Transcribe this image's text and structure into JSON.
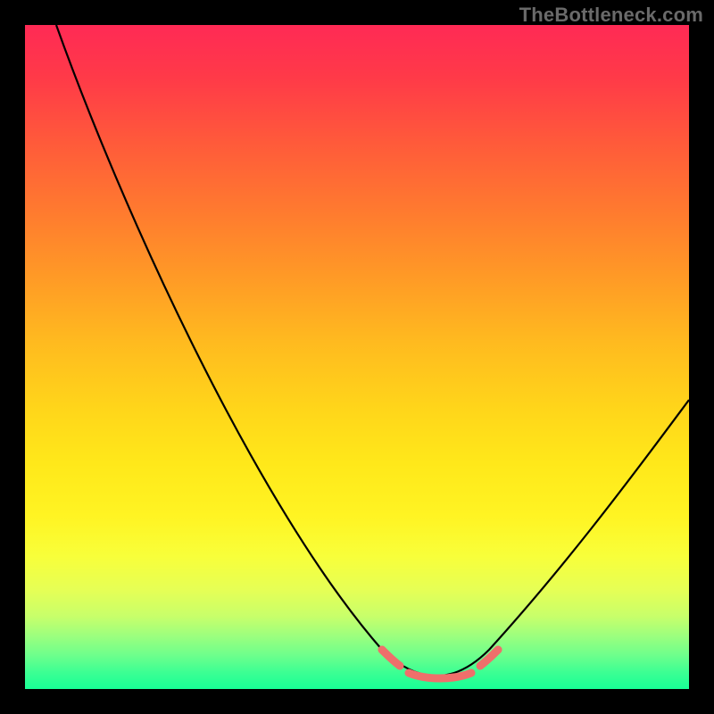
{
  "watermark": "TheBottleneck.com",
  "colors": {
    "frame_background": "#000000",
    "curve_stroke": "#000000",
    "accent_stroke": "#ef6f6b",
    "gradient_top": "#ff2a55",
    "gradient_bottom": "#18ff96",
    "watermark_text": "#6a6a6a"
  },
  "chart_data": {
    "type": "line",
    "title": "",
    "xlabel": "",
    "ylabel": "",
    "xlim": [
      0,
      100
    ],
    "ylim": [
      0,
      100
    ],
    "grid": false,
    "legend": false,
    "background": "vertical heat gradient (red high → green low)",
    "series": [
      {
        "name": "bottleneck-curve",
        "x": [
          5,
          10,
          20,
          30,
          40,
          50,
          54,
          58,
          62,
          66,
          70,
          75,
          80,
          90,
          100
        ],
        "values": [
          100,
          88,
          70,
          53,
          38,
          22,
          10,
          4,
          1,
          1,
          4,
          12,
          22,
          35,
          44
        ]
      }
    ],
    "optimal_range_x": [
      54,
      71
    ],
    "minimum": {
      "x": 64,
      "value": 1
    }
  }
}
